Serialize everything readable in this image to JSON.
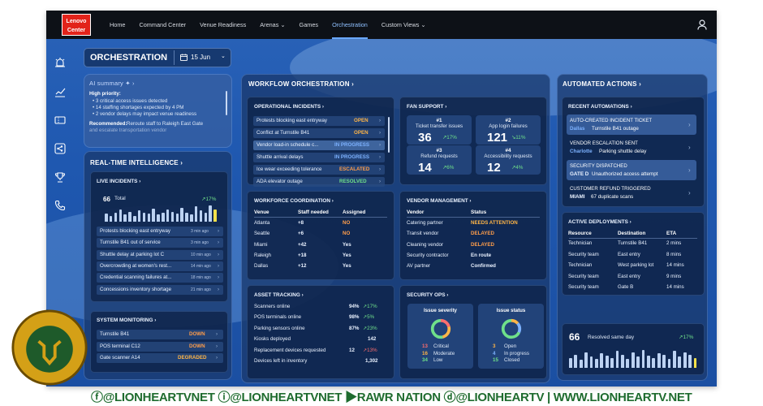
{
  "nav": {
    "logo_line1": "Lenovo",
    "logo_line2": "Center",
    "items": [
      "Home",
      "Command Center",
      "Venue Readiness",
      "Arenas ⌄",
      "Games",
      "Orchestration",
      "Custom Views ⌄"
    ]
  },
  "header": {
    "title": "ORCHESTRATION",
    "date": "15 Jun"
  },
  "ai": {
    "title": "AI summary ✦ ›",
    "priority": "High priority:",
    "bullets": [
      "• 3 critical access issues detected",
      "• 14 staffing shortages expected by 4 PM",
      "• 2 vendor delays may impact venue readiness"
    ],
    "rec_label": "Recommended:",
    "rec_text": "Reroute staff to Raleigh East Gate",
    "rec_more": "and escalate transportation vendor"
  },
  "rti": {
    "title": "REAL-TIME INTELLIGENCE ›",
    "incidents_title": "LIVE INCIDENTS ›",
    "total": "66",
    "total_label": "Total",
    "change": "↗17%",
    "bars": [
      8,
      6,
      9,
      12,
      7,
      10,
      6,
      11,
      9,
      8,
      13,
      7,
      9,
      12,
      10,
      8,
      14,
      9,
      7,
      15,
      11,
      9,
      16,
      12
    ],
    "items": [
      {
        "text": "Protests blocking east entryway",
        "time": "3 min ago"
      },
      {
        "text": "Turnstile B41 out of service",
        "time": "3 min ago"
      },
      {
        "text": "Shuttle delay at parking lot C",
        "time": "10 min ago"
      },
      {
        "text": "Overcrowding at women's rest...",
        "time": "14 min ago"
      },
      {
        "text": "Credential scanning failures at...",
        "time": "18 min ago"
      },
      {
        "text": "Concessions inventory shortage",
        "time": "21 min ago"
      }
    ]
  },
  "sysmon": {
    "title": "SYSTEM MONITORING ›",
    "items": [
      {
        "name": "Turnstile B41",
        "status": "DOWN"
      },
      {
        "name": "POS terminal C12",
        "status": "DOWN"
      },
      {
        "name": "Gate scanner A14",
        "status": "DEGRADED"
      }
    ]
  },
  "wf": {
    "title": "WORKFLOW ORCHESTRATION ›",
    "ops_title": "OPERATIONAL INCIDENTS ›",
    "ops": [
      {
        "name": "Protests blocking east entryway",
        "status": "OPEN"
      },
      {
        "name": "Conflict at Turnstile B41",
        "status": "OPEN"
      },
      {
        "name": "Vendor load-in schedule c...",
        "status": "IN PROGRESS"
      },
      {
        "name": "Shuttle arrival delays",
        "status": "IN PROGRESS"
      },
      {
        "name": "Ice wear exceeding tolerance",
        "status": "ESCALATED"
      },
      {
        "name": "ADA elevator outage",
        "status": "RESOLVED"
      }
    ],
    "fan_title": "FAN SUPPORT ›",
    "fan": [
      {
        "rank": "#1",
        "label": "Ticket transfer issues",
        "value": "36",
        "change": "↗17%"
      },
      {
        "rank": "#2",
        "label": "App login failures",
        "value": "121",
        "change": "↘11%"
      },
      {
        "rank": "#3",
        "label": "Refund requests",
        "value": "14",
        "change": "↗6%"
      },
      {
        "rank": "#4",
        "label": "Accessibility requests",
        "value": "12",
        "change": "↗4%"
      }
    ],
    "wfc_title": "WORKFORCE COORDINATION ›",
    "wfc_cols": [
      "Venue",
      "Staff needed",
      "Assigned"
    ],
    "wfc": [
      [
        "Atlanta",
        "+8",
        "NO"
      ],
      [
        "Seattle",
        "+6",
        "NO"
      ],
      [
        "Miami",
        "+42",
        "Yes"
      ],
      [
        "Raleigh",
        "+18",
        "Yes"
      ],
      [
        "Dallas",
        "+12",
        "Yes"
      ]
    ],
    "vm_title": "VENDOR MANAGEMENT ›",
    "vm_cols": [
      "Vendor",
      "Status"
    ],
    "vm": [
      [
        "Catering partner",
        "NEEDS ATTENTION"
      ],
      [
        "Transit vendor",
        "DELAYED"
      ],
      [
        "Cleaning vendor",
        "DELAYED"
      ],
      [
        "Security contractor",
        "En route"
      ],
      [
        "AV partner",
        "Confirmed"
      ]
    ],
    "at_title": "ASSET TRACKING ›",
    "at": [
      {
        "name": "Scanners online",
        "pct": "94%",
        "chg": "↗17%"
      },
      {
        "name": "POS terminals online",
        "pct": "98%",
        "chg": "↗5%"
      },
      {
        "name": "Parking sensors online",
        "pct": "87%",
        "chg": "↗23%"
      },
      {
        "name": "Kiosks deployed",
        "pct": "142",
        "chg": ""
      },
      {
        "name": "Replacement devices requested",
        "pct": "12",
        "chg": "↗13%"
      },
      {
        "name": "Devices left in inventory",
        "pct": "1,302",
        "chg": ""
      }
    ],
    "so_title": "SECURITY OPS ›",
    "sev_title": "Issue severity",
    "sev": [
      {
        "n": "13",
        "l": "Critical"
      },
      {
        "n": "16",
        "l": "Moderate"
      },
      {
        "n": "34",
        "l": "Low"
      }
    ],
    "stat_title": "Issue status",
    "stat": [
      {
        "n": "3",
        "l": "Open"
      },
      {
        "n": "4",
        "l": "In progress"
      },
      {
        "n": "15",
        "l": "Closed"
      }
    ]
  },
  "aa": {
    "title": "AUTOMATED ACTIONS ›",
    "recent_title": "RECENT AUTOMATIONS ›",
    "recent": [
      {
        "head": "AUTO-CREATED INCIDENT TICKET",
        "loc": "Dallas",
        "desc": "Turnstile B41 outage"
      },
      {
        "head": "VENDOR ESCALATION SENT",
        "loc": "Charlotte",
        "desc": "Parking shuttle delay"
      },
      {
        "head": "SECURITY DISPATCHED",
        "loc": "GATE D",
        "desc": "Unauthorized access attempt"
      },
      {
        "head": "CUSTOMER REFUND TRIGGERED",
        "loc": "MIAMI",
        "desc": "67 duplicate scans"
      }
    ],
    "dep_title": "ACTIVE DEPLOYMENTS ›",
    "dep_cols": [
      "Resource",
      "Destination",
      "ETA"
    ],
    "dep": [
      [
        "Technician",
        "Turnstile B41",
        "2 mins"
      ],
      [
        "Security team",
        "East entry",
        "8 mins"
      ],
      [
        "Technician",
        "West parking lot",
        "14 mins"
      ],
      [
        "Security team",
        "East entry",
        "9 mins"
      ],
      [
        "Security team",
        "Gate B",
        "14 mins"
      ]
    ],
    "resolved": "66",
    "resolved_label": "Resolved same day",
    "resolved_chg": "↗17%",
    "bars": [
      9,
      12,
      7,
      14,
      10,
      8,
      13,
      11,
      9,
      15,
      12,
      8,
      14,
      10,
      16,
      11,
      9,
      13,
      12,
      8,
      15,
      10,
      14,
      12,
      9
    ]
  },
  "colors": {
    "open": "#ffb547",
    "progress": "#7db2ff",
    "escalated": "#ff9d4a",
    "resolved": "#6fe08a",
    "critical": "#ff6e6e",
    "moderate": "#ffb547",
    "low": "#6fe08a"
  },
  "watermark": {
    "text": "ⓕ@LIONHEARTVNET  ⓘ@LIONHEARTVNET  ▶RAWR NATION  ⓓ@LIONHEARTV | WWW.LIONHEARTV.NET"
  }
}
